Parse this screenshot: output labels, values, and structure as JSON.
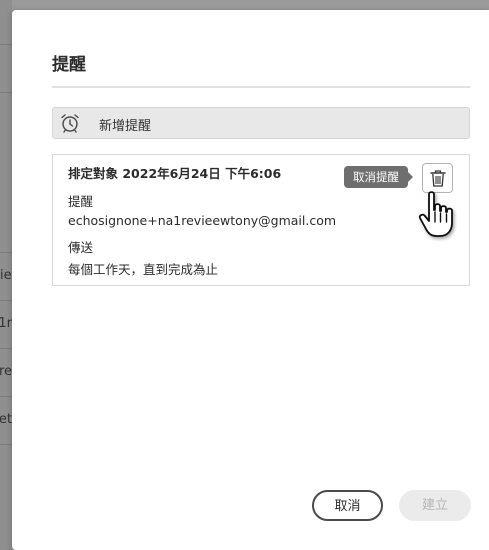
{
  "background": {
    "fragments": [
      "ie",
      "1r",
      "re",
      "iet"
    ]
  },
  "dialog": {
    "title": "提醒",
    "add_reminder_label": "新增提醒",
    "reminder": {
      "schedule": "排定對象 2022年6月24日 下午6:06",
      "recipient_label": "提醒",
      "recipient_email": "echosignone+na1revieewtony@gmail.com",
      "frequency_label": "傳送",
      "frequency_value": "每個工作天，直到完成為止",
      "delete_tooltip": "取消提醒"
    },
    "buttons": {
      "cancel": "取消",
      "create": "建立"
    }
  },
  "icons": {
    "add_reminder": "alarm-clock-icon",
    "delete": "trash-icon",
    "cursor": "hand-pointer-icon"
  },
  "colors": {
    "dialog_bg": "#ffffff",
    "tooltip_bg": "#6e6e6e",
    "disabled_button_bg": "#ebebeb"
  }
}
